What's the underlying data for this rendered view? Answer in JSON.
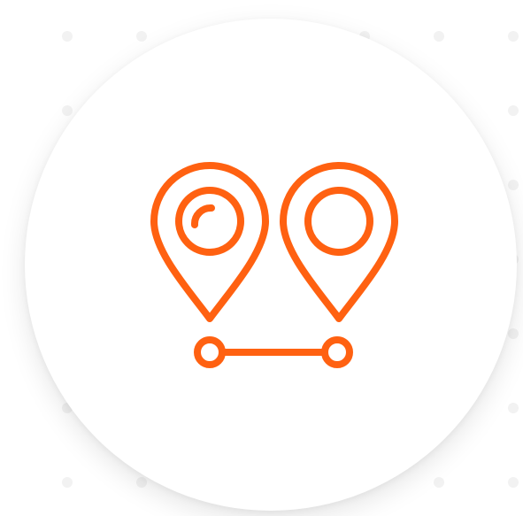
{
  "icon": {
    "name": "route-pins-icon",
    "color": "#FF6111"
  },
  "background": {
    "page_color": "#FFFFFF",
    "dot_color": "#F2F2F2",
    "card_color": "#FFFFFF"
  }
}
